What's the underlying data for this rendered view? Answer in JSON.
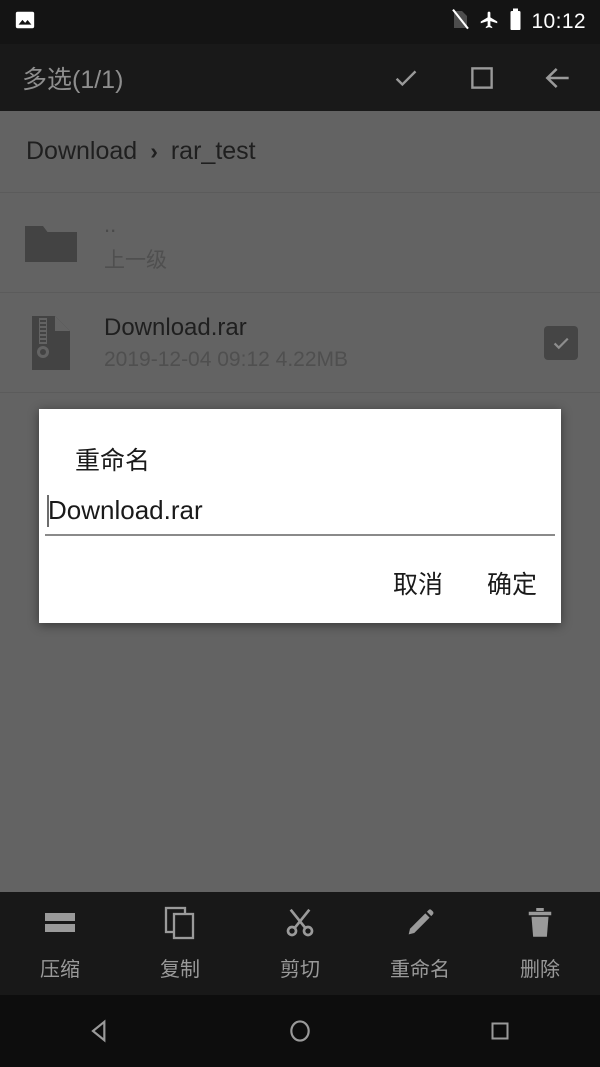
{
  "status_bar": {
    "notification_icon": "image-icon",
    "signal_icon": "no-sim-icon",
    "airplane_icon": "airplane-mode-icon",
    "battery_icon": "battery-full-icon",
    "time": "10:12"
  },
  "action_bar": {
    "title": "多选(1/1)",
    "select_all_icon": "check-icon",
    "deselect_all_icon": "square-icon",
    "back_icon": "arrow-left-icon"
  },
  "breadcrumb": {
    "segments": [
      "Download",
      "rar_test"
    ],
    "separator": "›"
  },
  "file_list": [
    {
      "name": "..",
      "subtitle": "上一级",
      "icon": "folder-icon",
      "checked": null
    },
    {
      "name": "Download.rar",
      "subtitle": "2019-12-04 09:12  4.22MB",
      "icon": "archive-file-icon",
      "checked": true
    }
  ],
  "dialog": {
    "title": "重命名",
    "input_value": "Download.rar",
    "input_placeholder": "",
    "cancel_label": "取消",
    "confirm_label": "确定"
  },
  "toolbar": {
    "items": [
      {
        "label": "压缩",
        "icon": "compress-icon"
      },
      {
        "label": "复制",
        "icon": "copy-icon"
      },
      {
        "label": "剪切",
        "icon": "cut-icon"
      },
      {
        "label": "重命名",
        "icon": "pencil-icon"
      },
      {
        "label": "删除",
        "icon": "trash-icon"
      }
    ]
  },
  "navbar": {
    "back_icon": "nav-back-triangle-icon",
    "home_icon": "nav-home-circle-icon",
    "recents_icon": "nav-recents-square-icon"
  },
  "colors": {
    "status_bar_bg": "#141414",
    "action_bar_bg": "#191919",
    "scrim_bg": "#636363",
    "dialog_bg": "#ffffff",
    "toolbar_bg": "#181818",
    "navbar_bg": "#0d0d0d",
    "icon_muted": "#9a9a9a"
  }
}
